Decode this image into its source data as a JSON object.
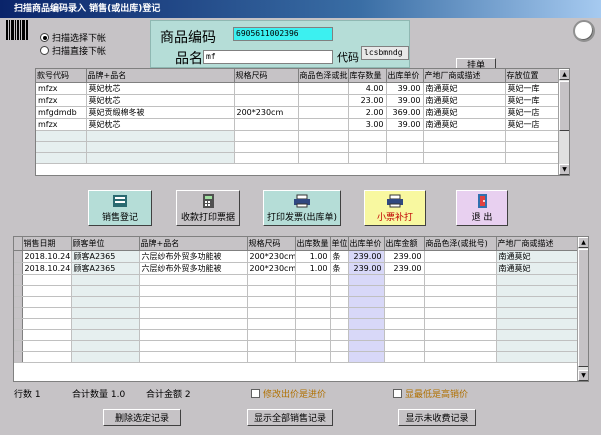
{
  "window": {
    "title": "扫描商品编码录入   销售(或出库)登记"
  },
  "mode": {
    "options": [
      {
        "label": "扫描选择下帐",
        "selected": true
      },
      {
        "label": "扫描直接下帐",
        "selected": false
      }
    ]
  },
  "form": {
    "code_label": "商品编码",
    "code_value": "69056110023​96",
    "name_label": "品名",
    "name_value": "mf",
    "dm_label": "代码",
    "dm_value": "lcsbmndg",
    "float_btn": "挂单"
  },
  "stock_table": {
    "columns": [
      "款号代码",
      "品牌+品名",
      "规格尺码",
      "商品色泽或批号",
      "库存数量",
      "出库单价",
      "产地厂商或描述",
      "存放位置"
    ],
    "rows": [
      [
        "mfzx",
        "莫妃枕芯",
        "",
        "",
        "4.00",
        "39.00",
        "南通莫妃",
        "莫妃一库"
      ],
      [
        "mfzx",
        "莫妃枕芯",
        "",
        "",
        "23.00",
        "39.00",
        "南通莫妃",
        "莫妃一库"
      ],
      [
        "mfgdmdb",
        "莫妃贡缎棉冬被",
        "200*230cm",
        "",
        "2.00",
        "369.00",
        "南通莫妃",
        "莫妃一店"
      ],
      [
        "mfzx",
        "莫妃枕芯",
        "",
        "",
        "3.00",
        "39.00",
        "南通莫妃",
        "莫妃一店"
      ]
    ]
  },
  "actions": [
    {
      "label": "销售登记",
      "icon": "register-icon"
    },
    {
      "label": "收款打印票据",
      "icon": "calculator-icon"
    },
    {
      "label": "打印发票(出库单)",
      "icon": "printer-icon"
    },
    {
      "label": "小票补打",
      "icon": "receipt-printer-icon"
    },
    {
      "label": "退 出",
      "icon": "exit-door-icon"
    }
  ],
  "sales_table": {
    "columns": [
      "销售日期",
      "顾客单位",
      "品牌+品名",
      "规格尺码",
      "出库数量",
      "单位",
      "出库单价",
      "出库金额",
      "商品色泽(或批号)",
      "产地厂商或描述"
    ],
    "rows": [
      [
        "2018.10.24",
        "顾客A2365",
        "六层纱布外贸多功能被",
        "200*230cm",
        "1.00",
        "条",
        "239.00",
        "239.00",
        "",
        "南通莫妃"
      ],
      [
        "2018.10.24",
        "顾客A2365",
        "六层纱布外贸多功能被",
        "200*230cm",
        "1.00",
        "条",
        "239.00",
        "239.00",
        "",
        "南通莫妃"
      ]
    ]
  },
  "status": {
    "rows_label": "行数 1",
    "qty_label": "合计数量 1.0",
    "amount_label": "合计金额 2",
    "chk_price_label": "修改出价是进价",
    "chk_low_label": "显最低是高销价"
  },
  "bottom_buttons": {
    "delete": "删除选定记录",
    "show_all": "显示全部销售记录",
    "show_unpaid": "显示未收费记录"
  },
  "colors": {
    "title_bg": "#0a246a",
    "code_input_bg": "#3cf0f0",
    "panel_bg": "#b5ddd7",
    "btn_register": "#b5ddd7",
    "btn_calc": "#c6c3c6",
    "btn_print": "#b5ddd7",
    "btn_receipt": "#f8f8a0",
    "btn_exit": "#e8d0f0"
  }
}
